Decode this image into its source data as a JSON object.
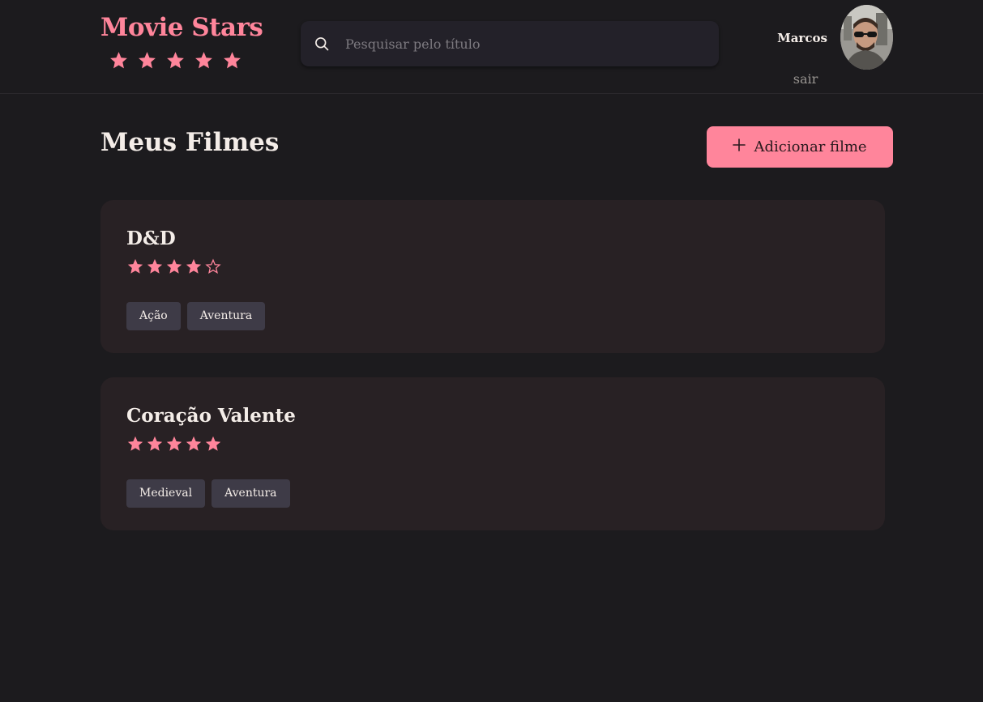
{
  "brand": {
    "title": "Movie Stars",
    "stars": 5
  },
  "search": {
    "placeholder": "Pesquisar pelo título"
  },
  "user": {
    "name": "Marcos",
    "logout_label": "sair"
  },
  "page": {
    "title": "Meus Filmes",
    "add_button_label": "Adicionar filme"
  },
  "colors": {
    "accent": "#ff859b",
    "background": "#1c1b1e",
    "card": "#282124",
    "tag": "#3e3b47"
  },
  "movies": [
    {
      "title": "D&D",
      "rating": 4,
      "max_rating": 5,
      "tags": [
        "Ação",
        "Aventura"
      ]
    },
    {
      "title": "Coração Valente",
      "rating": 5,
      "max_rating": 5,
      "tags": [
        "Medieval",
        "Aventura"
      ]
    }
  ]
}
